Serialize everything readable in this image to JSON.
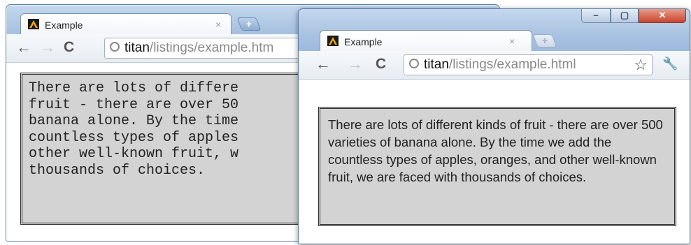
{
  "back_window": {
    "tab": {
      "title": "Example",
      "close": "×"
    },
    "new_tab": "+",
    "toolbar": {
      "back": "←",
      "forward": "→",
      "reload": "C"
    },
    "omnibox": {
      "host": "titan",
      "path": "/listings/example.htm"
    },
    "paragraph_lines": [
      "There are lots of differe",
      "fruit - there are over 50",
      "banana alone. By the time",
      "countless types of apples",
      "other well-known fruit, w",
      "thousands of choices."
    ]
  },
  "front_window": {
    "tab": {
      "title": "Example",
      "close": "×"
    },
    "new_tab": "+",
    "toolbar": {
      "back": "←",
      "forward": "→",
      "reload": "C",
      "star": "☆",
      "wrench": "🔧"
    },
    "omnibox": {
      "host": "titan",
      "path": "/listings/example.html"
    },
    "window_controls": {
      "minimize": "–",
      "maximize": "▢",
      "close": "✕"
    },
    "paragraph": "There are lots of different kinds of fruit - there are over 500 varieties of banana alone. By the time we add the countless types of apples, oranges, and other well-known fruit, we are faced with thousands of choices."
  }
}
